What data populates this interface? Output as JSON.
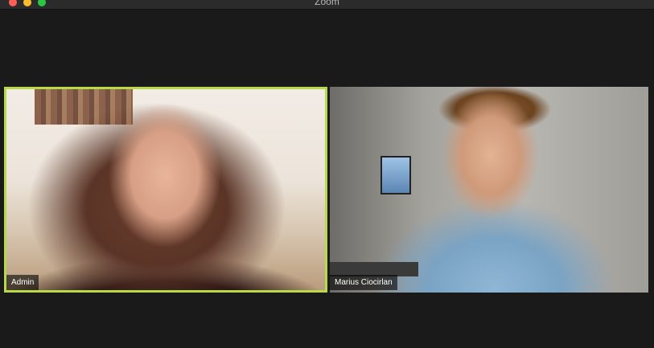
{
  "window": {
    "title": "Zoom"
  },
  "participants": [
    {
      "name": "Admin",
      "active_speaker": true
    },
    {
      "name": "Marius Ciocirlan",
      "active_speaker": false
    }
  ],
  "colors": {
    "active_border": "#b8d94a",
    "background": "#1a1a1a"
  }
}
